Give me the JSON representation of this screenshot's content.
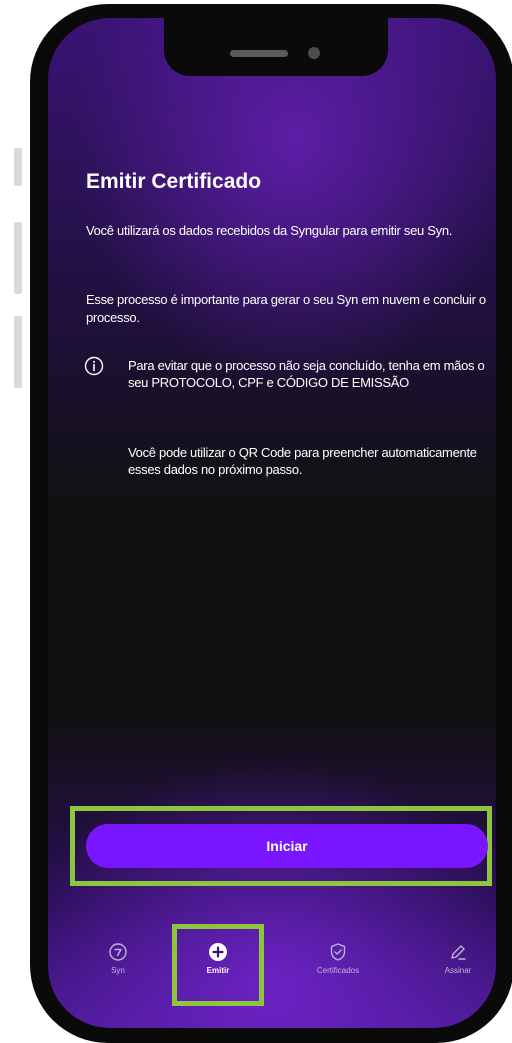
{
  "screen": {
    "title": "Emitir Certificado",
    "paragraph_1": "Você utilizará os dados recebidos da Syngular para emitir seu Syn.",
    "paragraph_2": "Esse processo é importante para gerar o seu Syn em nuvem e concluir o processo.",
    "info_note": "Para evitar que o processo não seja concluído, tenha em mãos o seu PROTOCOLO, CPF e CÓDIGO DE EMISSÃO",
    "qr_note": "Você pode utilizar o QR Code para preencher automaticamente esses dados no próximo passo."
  },
  "actions": {
    "start_label": "Iniciar"
  },
  "bottom_nav": {
    "items": [
      {
        "label": "Syn",
        "icon": "syn-icon"
      },
      {
        "label": "Emitir",
        "icon": "plus-circle-icon",
        "active": true
      },
      {
        "label": "Certificados",
        "icon": "shield-icon"
      },
      {
        "label": "Assinar",
        "icon": "pen-icon"
      }
    ]
  },
  "colors": {
    "accent": "#7a16ff",
    "highlight": "#8cc63f",
    "text": "#ffffff"
  }
}
